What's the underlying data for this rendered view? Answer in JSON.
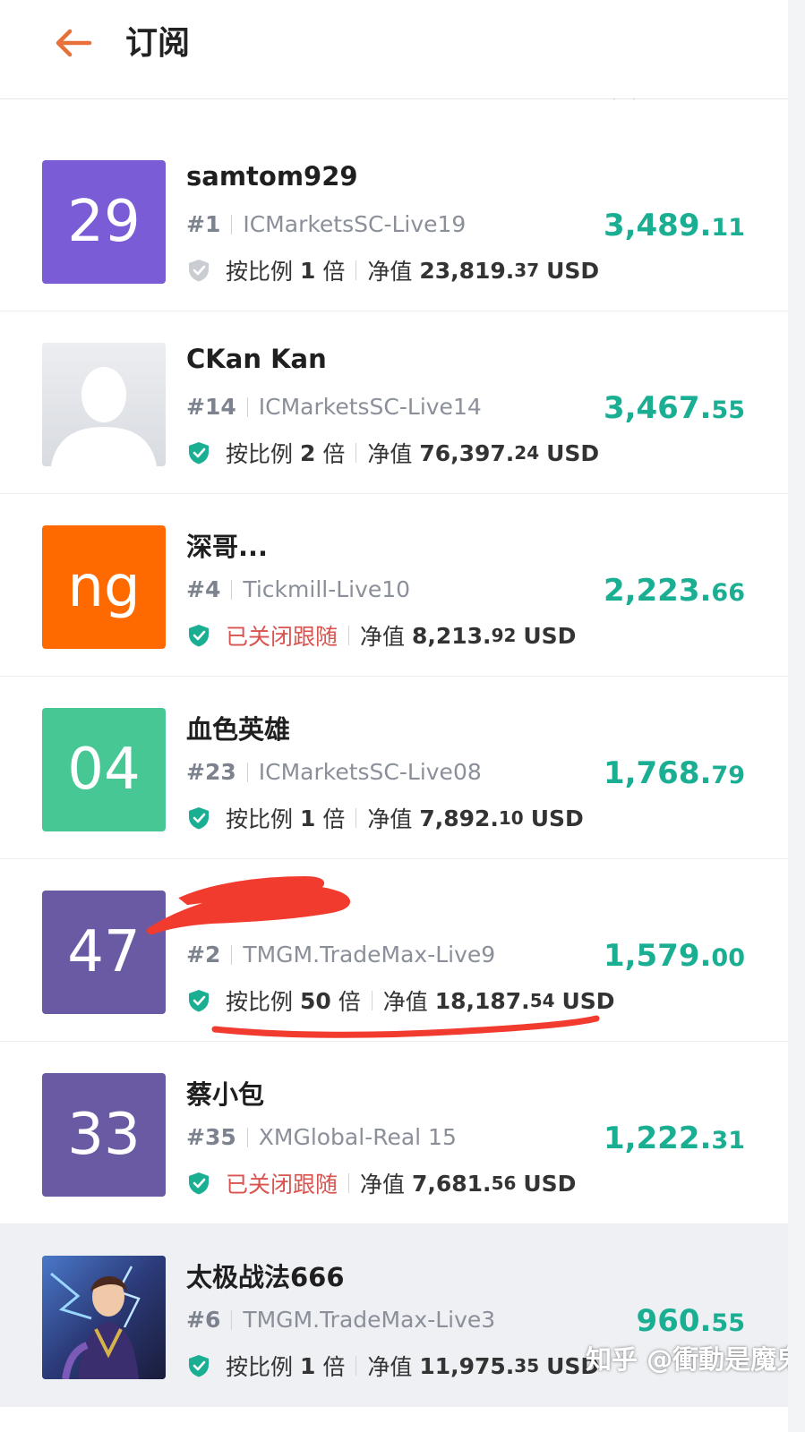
{
  "header": {
    "title": "订阅"
  },
  "colors": {
    "accent_back": "#e8703a",
    "amount_green": "#1aaf93",
    "shield_green": "#1aaf93",
    "closed_red": "#d9534f"
  },
  "rows": [
    {
      "avatar_text": "29",
      "avatar_color": "#7a5cd6",
      "name": "samtom929",
      "rank": "#1",
      "server": "ICMarketsSC-Live19",
      "shield_icon": "shield-gray-icon",
      "follow_label": "按比例",
      "follow_value": "1",
      "follow_unit": "倍",
      "status_closed": "",
      "equity_label": "净值",
      "equity_int": "23,819.",
      "equity_dec": "37",
      "equity_unit": "USD",
      "amount_int": "3,489.",
      "amount_dec": "11"
    },
    {
      "avatar_text": "",
      "avatar_color": "#e4e7ec",
      "avatar_icon": "person-placeholder-icon",
      "name": "CKan Kan",
      "rank": "#14",
      "server": "ICMarketsSC-Live14",
      "shield_icon": "shield-green-icon",
      "follow_label": "按比例",
      "follow_value": "2",
      "follow_unit": "倍",
      "status_closed": "",
      "equity_label": "净值",
      "equity_int": "76,397.",
      "equity_dec": "24",
      "equity_unit": "USD",
      "amount_int": "3,467.",
      "amount_dec": "55"
    },
    {
      "avatar_text": "ng",
      "avatar_color": "#ff6a00",
      "name": "深哥...",
      "rank": "#4",
      "server": "Tickmill-Live10",
      "shield_icon": "shield-green-icon",
      "follow_label": "",
      "follow_value": "",
      "follow_unit": "",
      "status_closed": "已关闭跟随",
      "equity_label": "净值",
      "equity_int": "8,213.",
      "equity_dec": "92",
      "equity_unit": "USD",
      "amount_int": "2,223.",
      "amount_dec": "66"
    },
    {
      "avatar_text": "04",
      "avatar_color": "#46c794",
      "name": "血色英雄",
      "rank": "#23",
      "server": "ICMarketsSC-Live08",
      "shield_icon": "shield-green-icon",
      "follow_label": "按比例",
      "follow_value": "1",
      "follow_unit": "倍",
      "status_closed": "",
      "equity_label": "净值",
      "equity_int": "7,892.",
      "equity_dec": "10",
      "equity_unit": "USD",
      "amount_int": "1,768.",
      "amount_dec": "79"
    },
    {
      "avatar_text": "47",
      "avatar_color": "#6a5aa3",
      "name": "",
      "rank": "#2",
      "server": "TMGM.TradeMax-Live9",
      "shield_icon": "shield-green-icon",
      "follow_label": "按比例",
      "follow_value": "50",
      "follow_unit": "倍",
      "status_closed": "",
      "equity_label": "净值",
      "equity_int": "18,187.",
      "equity_dec": "54",
      "equity_unit": "USD",
      "amount_int": "1,579.",
      "amount_dec": "00"
    },
    {
      "avatar_text": "33",
      "avatar_color": "#6a5aa3",
      "name": "蔡小包",
      "rank": "#35",
      "server": "XMGlobal-Real 15",
      "shield_icon": "shield-green-icon",
      "follow_label": "",
      "follow_value": "",
      "follow_unit": "",
      "status_closed": "已关闭跟随",
      "equity_label": "净值",
      "equity_int": "7,681.",
      "equity_dec": "56",
      "equity_unit": "USD",
      "amount_int": "1,222.",
      "amount_dec": "31"
    },
    {
      "avatar_text": "",
      "avatar_color": "#2a3566",
      "avatar_icon": "game-character-avatar-icon",
      "name": "太极战法666",
      "rank": "#6",
      "server": "TMGM.TradeMax-Live3",
      "shield_icon": "shield-green-icon",
      "follow_label": "按比例",
      "follow_value": "1",
      "follow_unit": "倍",
      "status_closed": "",
      "equity_label": "净值",
      "equity_int": "11,975.",
      "equity_dec": "35",
      "equity_unit": "USD",
      "amount_int": "960.",
      "amount_dec": "55"
    }
  ],
  "watermark": "知乎 @衝動是魔鬼"
}
